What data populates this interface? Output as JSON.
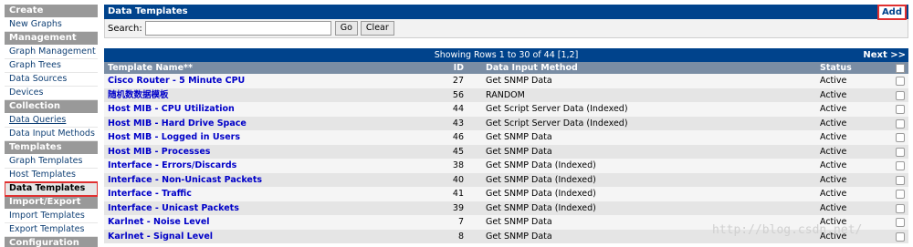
{
  "sidebar": {
    "items": [
      {
        "type": "head",
        "label": "Create"
      },
      {
        "type": "item",
        "label": "New Graphs"
      },
      {
        "type": "head",
        "label": "Management"
      },
      {
        "type": "item",
        "label": "Graph Management"
      },
      {
        "type": "item",
        "label": "Graph Trees"
      },
      {
        "type": "item",
        "label": "Data Sources"
      },
      {
        "type": "item",
        "label": "Devices"
      },
      {
        "type": "head",
        "label": "Collection Methods"
      },
      {
        "type": "item",
        "label": "Data Queries",
        "underline": true
      },
      {
        "type": "item",
        "label": "Data Input Methods"
      },
      {
        "type": "head",
        "label": "Templates"
      },
      {
        "type": "item",
        "label": "Graph Templates"
      },
      {
        "type": "item",
        "label": "Host Templates"
      },
      {
        "type": "item",
        "label": "Data Templates",
        "active": true
      },
      {
        "type": "head",
        "label": "Import/Export"
      },
      {
        "type": "item",
        "label": "Import Templates"
      },
      {
        "type": "item",
        "label": "Export Templates"
      },
      {
        "type": "head",
        "label": "Configuration"
      }
    ]
  },
  "header": {
    "title": "Data Templates",
    "add_label": "Add"
  },
  "search": {
    "label": "Search:",
    "value": "",
    "go_label": "Go",
    "clear_label": "Clear"
  },
  "pagination": {
    "text": "Showing Rows 1 to 30 of 44 [1,2]",
    "next_label": "Next >>"
  },
  "columns": {
    "name": "Template Name**",
    "id": "ID",
    "method": "Data Input Method",
    "status": "Status"
  },
  "rows": [
    {
      "name": "Cisco Router - 5 Minute CPU",
      "id": "27",
      "method": "Get SNMP Data",
      "status": "Active"
    },
    {
      "name": "随机数数据模板",
      "id": "56",
      "method": "RANDOM",
      "status": "Active"
    },
    {
      "name": "Host MIB - CPU Utilization",
      "id": "44",
      "method": "Get Script Server Data (Indexed)",
      "status": "Active"
    },
    {
      "name": "Host MIB - Hard Drive Space",
      "id": "43",
      "method": "Get Script Server Data (Indexed)",
      "status": "Active"
    },
    {
      "name": "Host MIB - Logged in Users",
      "id": "46",
      "method": "Get SNMP Data",
      "status": "Active"
    },
    {
      "name": "Host MIB - Processes",
      "id": "45",
      "method": "Get SNMP Data",
      "status": "Active"
    },
    {
      "name": "Interface - Errors/Discards",
      "id": "38",
      "method": "Get SNMP Data (Indexed)",
      "status": "Active"
    },
    {
      "name": "Interface - Non-Unicast Packets",
      "id": "40",
      "method": "Get SNMP Data (Indexed)",
      "status": "Active"
    },
    {
      "name": "Interface - Traffic",
      "id": "41",
      "method": "Get SNMP Data (Indexed)",
      "status": "Active"
    },
    {
      "name": "Interface - Unicast Packets",
      "id": "39",
      "method": "Get SNMP Data (Indexed)",
      "status": "Active"
    },
    {
      "name": "Karlnet - Noise Level",
      "id": "7",
      "method": "Get SNMP Data",
      "status": "Active"
    },
    {
      "name": "Karlnet - Signal Level",
      "id": "8",
      "method": "Get SNMP Data",
      "status": "Active"
    }
  ],
  "watermark": "http://blog.csdn.net/"
}
